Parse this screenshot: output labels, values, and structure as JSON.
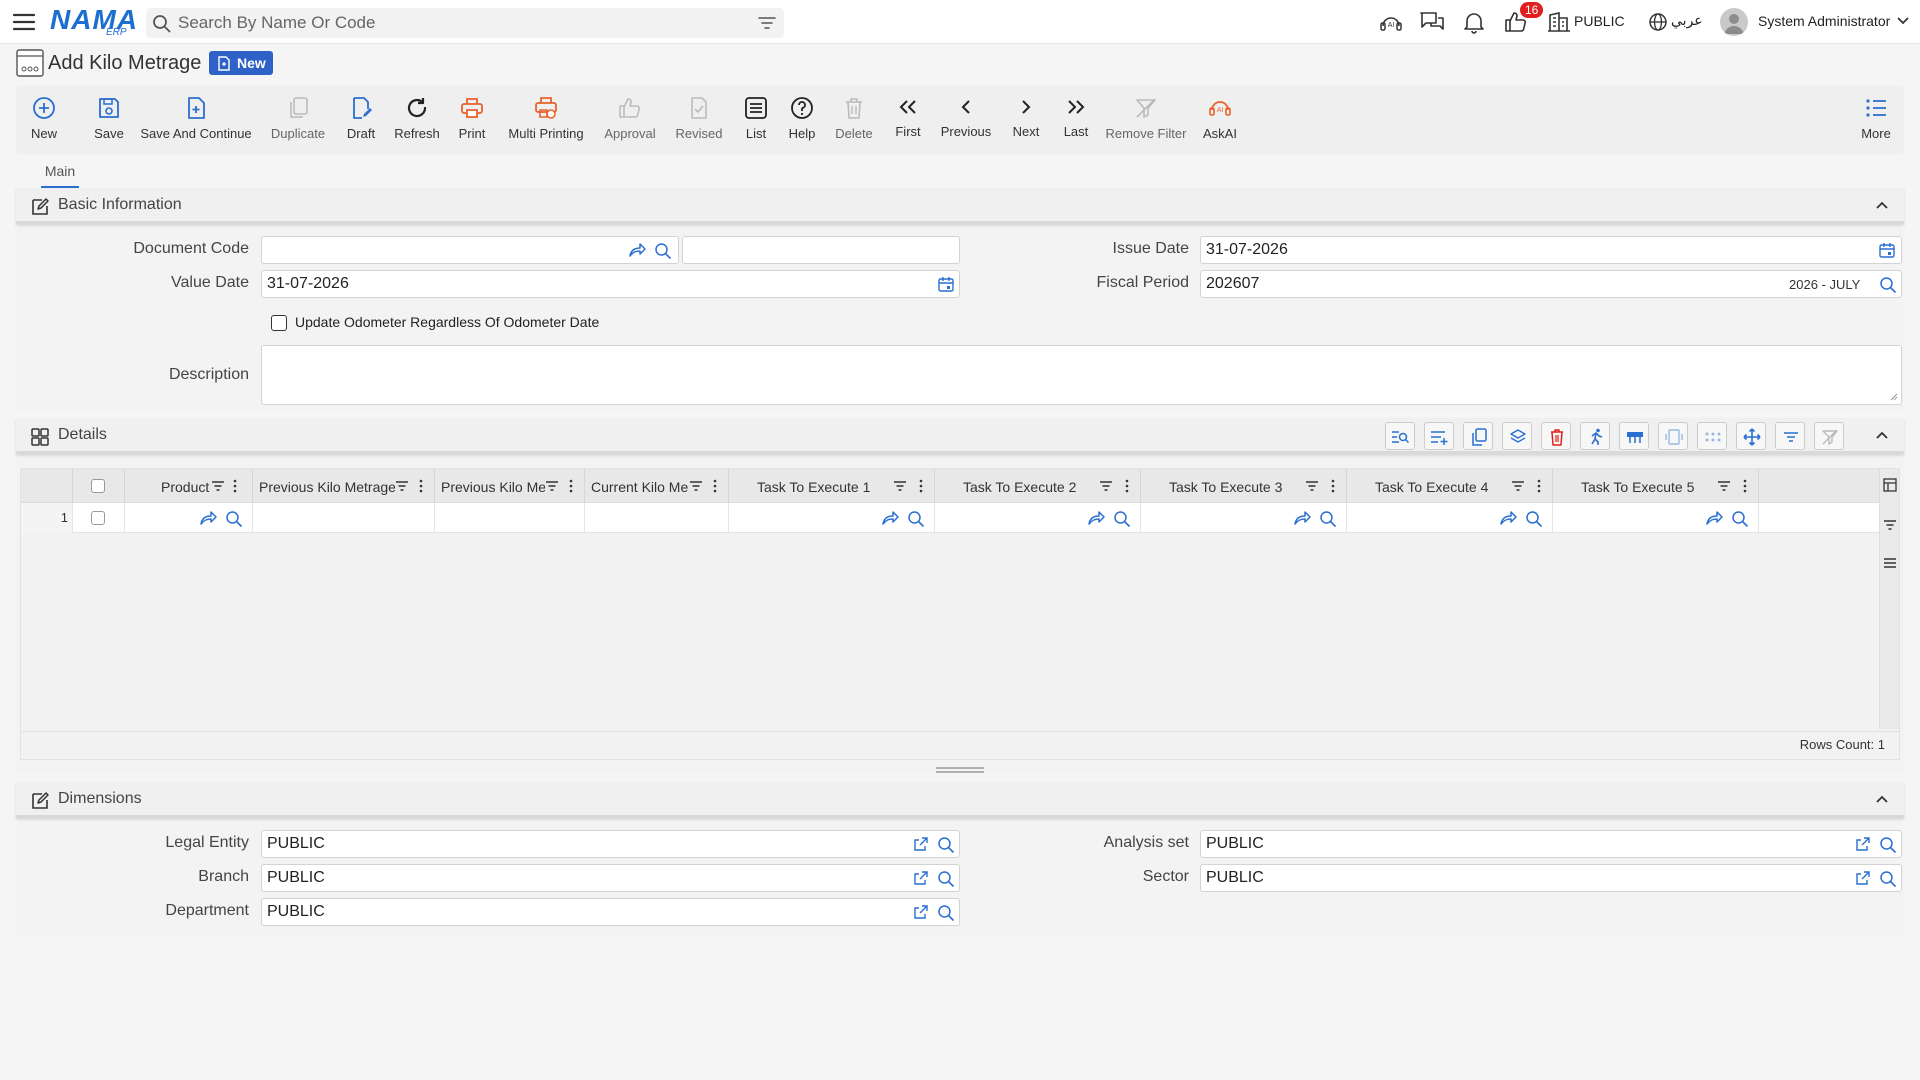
{
  "topbar": {
    "search_placeholder": "Search By Name Or Code",
    "notification_count": "16",
    "company": "PUBLIC",
    "language": "عربي",
    "user_name": "System Administrator"
  },
  "logo": {
    "text": "NAMA",
    "sub": "ERP"
  },
  "page": {
    "title": "Add Kilo Metrage",
    "status_badge": "New"
  },
  "toolbar": {
    "buttons": [
      {
        "label": "New",
        "icon": "plus-circle-icon"
      },
      {
        "label": "Save",
        "icon": "save-icon"
      },
      {
        "label": "Save And Continue",
        "icon": "save-continue-icon"
      },
      {
        "label": "Duplicate",
        "icon": "duplicate-icon"
      },
      {
        "label": "Draft",
        "icon": "draft-icon"
      },
      {
        "label": "Refresh",
        "icon": "refresh-icon"
      },
      {
        "label": "Print",
        "icon": "print-icon"
      },
      {
        "label": "Multi Printing",
        "icon": "multi-print-icon"
      },
      {
        "label": "Approval",
        "icon": "thumbs-up-icon"
      },
      {
        "label": "Revised",
        "icon": "revised-icon"
      },
      {
        "label": "List",
        "icon": "list-icon"
      },
      {
        "label": "Help",
        "icon": "help-icon"
      },
      {
        "label": "Delete",
        "icon": "trash-icon"
      },
      {
        "label": "First",
        "icon": "double-chevron-left-icon"
      },
      {
        "label": "Previous",
        "icon": "chevron-left-icon"
      },
      {
        "label": "Next",
        "icon": "chevron-right-icon"
      },
      {
        "label": "Last",
        "icon": "double-chevron-right-icon"
      },
      {
        "label": "Remove Filter",
        "icon": "remove-filter-icon"
      },
      {
        "label": "AskAI",
        "icon": "ai-icon"
      },
      {
        "label": "More",
        "icon": "more-list-icon"
      }
    ]
  },
  "tabs": [
    {
      "label": "Main"
    }
  ],
  "basic_info": {
    "title": "Basic Information",
    "document_code_label": "Document Code",
    "document_code_value": "",
    "document_code_name": "",
    "issue_date_label": "Issue Date",
    "issue_date_value": "31-07-2026",
    "value_date_label": "Value Date",
    "value_date_value": "31-07-2026",
    "fiscal_period_label": "Fiscal Period",
    "fiscal_period_value": "202607",
    "fiscal_period_name": "2026 - JULY",
    "update_odometer_label": "Update Odometer Regardless Of Odometer Date",
    "update_odometer_checked": false,
    "description_label": "Description",
    "description_value": ""
  },
  "details": {
    "title": "Details",
    "columns": [
      {
        "label": "Product"
      },
      {
        "label": "Previous Kilo Metrage"
      },
      {
        "label": "Previous Kilo Me"
      },
      {
        "label": "Current Kilo Me"
      },
      {
        "label": "Task To Execute 1"
      },
      {
        "label": "Task To Execute 2"
      },
      {
        "label": "Task To Execute 3"
      },
      {
        "label": "Task To Execute 4"
      },
      {
        "label": "Task To Execute 5"
      }
    ],
    "rows": [
      {
        "index": "1"
      }
    ],
    "rows_count_text": "Rows Count: 1"
  },
  "dimensions": {
    "title": "Dimensions",
    "legal_entity_label": "Legal Entity",
    "legal_entity_value": "PUBLIC",
    "branch_label": "Branch",
    "branch_value": "PUBLIC",
    "department_label": "Department",
    "department_value": "PUBLIC",
    "analysis_set_label": "Analysis set",
    "analysis_set_value": "PUBLIC",
    "sector_label": "Sector",
    "sector_value": "PUBLIC"
  },
  "colors": {
    "accent": "#2a6fd1",
    "orange": "#e8622c",
    "badge_red": "#e02020",
    "new_badge": "#2f62c6"
  }
}
